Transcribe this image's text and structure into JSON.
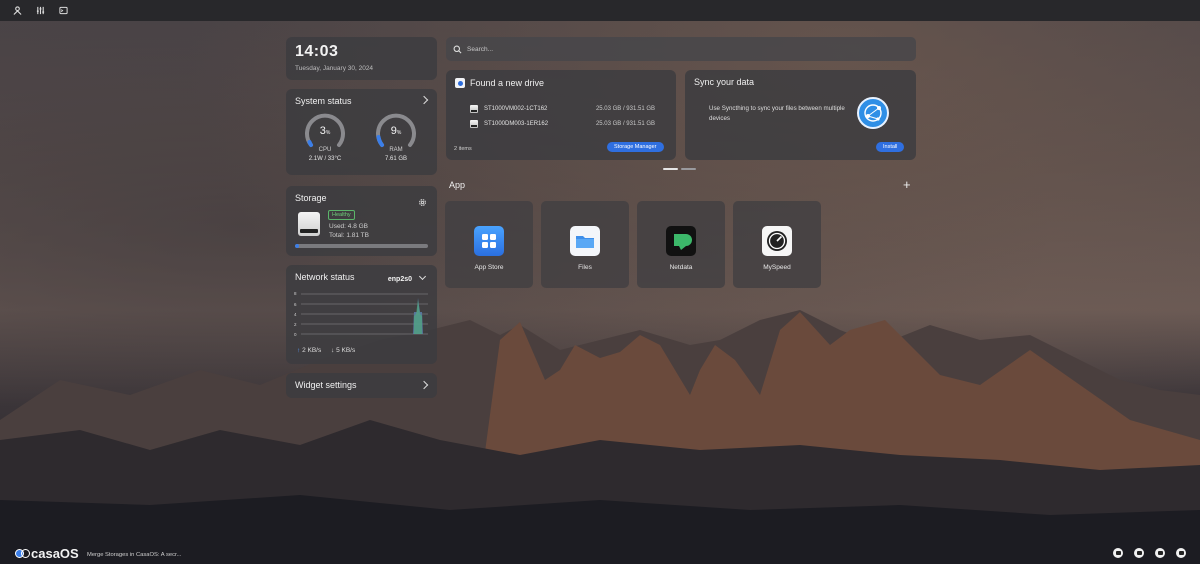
{
  "clock": {
    "time": "14:03",
    "date": "Tuesday, January 30, 2024"
  },
  "system_status": {
    "title": "System status",
    "cpu": {
      "value": "3",
      "unit": "%",
      "label": "CPU",
      "sub": "2.1W / 33°C",
      "percent": 3
    },
    "ram": {
      "value": "9",
      "unit": "%",
      "label": "RAM",
      "sub": "7.61 GB",
      "percent": 9
    }
  },
  "storage": {
    "title": "Storage",
    "health": "Healthy",
    "used": "Used: 4.8 GB",
    "total": "Total: 1.81 TB",
    "used_fraction": 0.03
  },
  "network": {
    "title": "Network status",
    "interface": "enp2s0",
    "y_ticks": [
      "8",
      "6",
      "4",
      "2",
      "0"
    ],
    "upload": "2 KB/s",
    "download": "5 KB/s",
    "upload_arrow": "↑",
    "download_arrow": "↓"
  },
  "widget_settings": {
    "title": "Widget settings"
  },
  "search": {
    "placeholder": "Search..."
  },
  "new_drive": {
    "title": "Found a new drive",
    "drives": [
      {
        "name": "ST1000VM002-1CT162",
        "size": "25.03 GB / 931.51 GB"
      },
      {
        "name": "ST1000DM003-1ER162",
        "size": "25.03 GB / 931.51 GB"
      }
    ],
    "count": "2 items",
    "button": "Storage Manager"
  },
  "sync": {
    "title": "Sync your data",
    "description": "Use Syncthing to sync your files between multiple devices",
    "button": "Install"
  },
  "apps": {
    "title": "App",
    "add_symbol": "+",
    "items": [
      {
        "name": "App Store",
        "icon": "app-store-icon"
      },
      {
        "name": "Files",
        "icon": "folder-icon"
      },
      {
        "name": "Netdata",
        "icon": "netdata-icon"
      },
      {
        "name": "MySpeed",
        "icon": "speedometer-icon"
      }
    ]
  },
  "footer": {
    "brand": "casaOS",
    "news": "Merge Storages in CasaOS: A secr..."
  },
  "colors": {
    "accent": "#2f6fe0",
    "healthy": "#6fcf7a",
    "card_bg": "#3c3c40",
    "topbar": "#28282b"
  }
}
